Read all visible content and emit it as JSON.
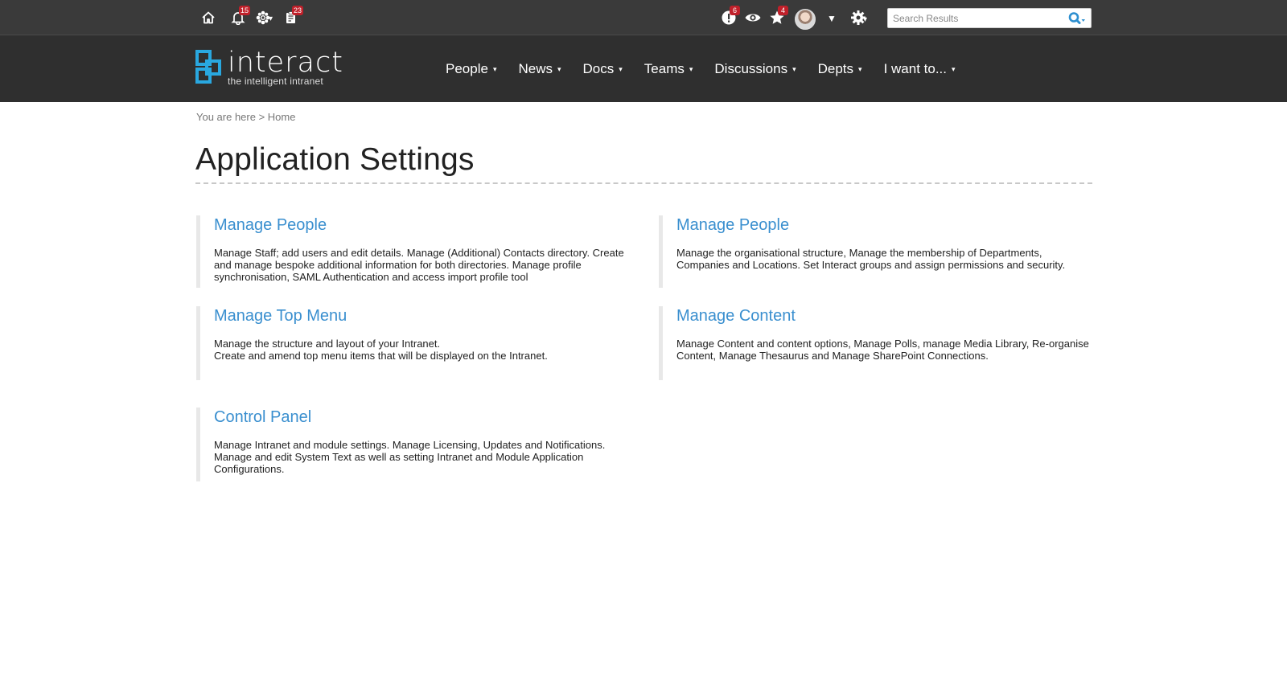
{
  "topbar": {
    "icons": [
      {
        "name": "home-icon"
      },
      {
        "name": "bell-icon",
        "badge": "15"
      },
      {
        "name": "flower-icon"
      },
      {
        "name": "tasks-icon",
        "badge": "23"
      }
    ],
    "right_icons": [
      {
        "name": "alert-icon",
        "badge": "6"
      },
      {
        "name": "eye-icon"
      },
      {
        "name": "star-icon",
        "badge": "4"
      },
      {
        "name": "settings-gear-icon"
      }
    ],
    "search": {
      "placeholder": "Search Results",
      "value": ""
    }
  },
  "brand": {
    "word": "interact",
    "tagline": "the intelligent intranet",
    "accent": "#29a8e0"
  },
  "nav": {
    "items": [
      {
        "label": "People"
      },
      {
        "label": "News"
      },
      {
        "label": "Docs"
      },
      {
        "label": "Teams"
      },
      {
        "label": "Discussions"
      },
      {
        "label": "Depts"
      },
      {
        "label": "I want to..."
      }
    ],
    "caret": "▾"
  },
  "breadcrumb": "You are here > Home",
  "page": {
    "title": "Application Settings"
  },
  "cards": [
    {
      "title": "Manage People",
      "desc": "Manage Staff; add users and edit details. Manage (Additional) Contacts directory. Create and manage bespoke additional information for both directories. Manage profile synchronisation, SAML Authentication and access import profile tool"
    },
    {
      "title": "Manage People",
      "desc": "Manage the organisational structure, Manage the membership of Departments, Companies and Locations. Set Interact groups and assign permissions and security."
    },
    {
      "title": "Manage Top Menu",
      "desc": "Manage the structure and layout of your Intranet.\nCreate and amend top menu items that will be displayed on the Intranet."
    },
    {
      "title": "Manage Content",
      "desc": "Manage Content and content options, Manage Polls, manage Media Library, Re-organise Content, Manage Thesaurus and Manage SharePoint Connections."
    },
    {
      "title": "Control Panel",
      "desc": "Manage Intranet and module settings. Manage Licensing, Updates and Notifications. Manage and edit System Text as well as setting Intranet and Module Application Configurations."
    }
  ],
  "colors": {
    "topbar_bg": "#3a3a3a",
    "header_bg": "#2f2f2f",
    "link": "#3a8fcf",
    "badge": "#c0202a"
  }
}
